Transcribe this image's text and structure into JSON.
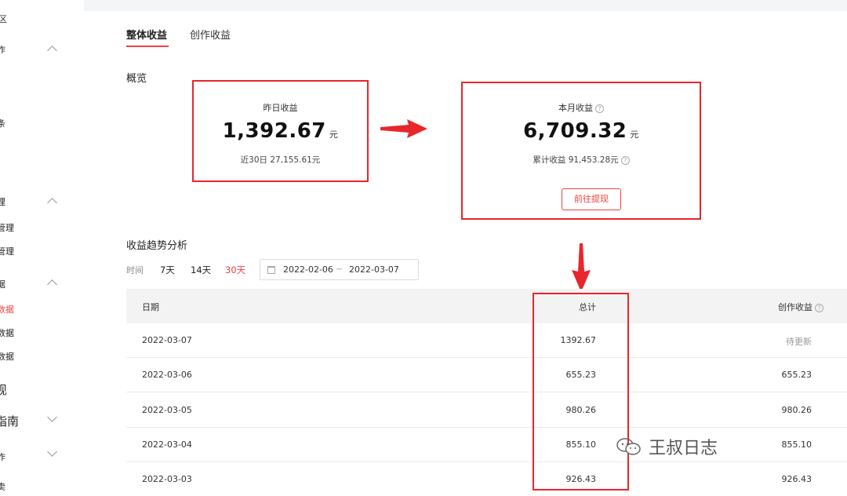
{
  "sidebar": {
    "items": [
      {
        "label": "区"
      },
      {
        "label": "作"
      },
      {
        "label": "条"
      },
      {
        "label": "理"
      },
      {
        "label": "管理"
      },
      {
        "label": "管理"
      },
      {
        "label": "据"
      },
      {
        "label": "数据"
      },
      {
        "label": "数据"
      },
      {
        "label": "数据"
      },
      {
        "label": "现"
      },
      {
        "label": "指南"
      },
      {
        "label": "作"
      },
      {
        "label": "卖"
      }
    ]
  },
  "tabs": [
    {
      "label": "整体收益",
      "active": true
    },
    {
      "label": "创作收益",
      "active": false
    }
  ],
  "overview": {
    "title": "概览",
    "yesterday": {
      "label": "昨日收益",
      "value": "1,392.67",
      "unit": "元",
      "sub": "近30日 27,155.61元"
    },
    "month": {
      "label": "本月收益",
      "value": "6,709.32",
      "unit": "元",
      "sub": "累计收益 91,453.28元",
      "button": "前往提现"
    }
  },
  "trend": {
    "title": "收益趋势分析",
    "filter_label": "时间",
    "ranges": [
      {
        "label": "7天",
        "active": false
      },
      {
        "label": "14天",
        "active": false
      },
      {
        "label": "30天",
        "active": true
      }
    ],
    "date_start": "2022-02-06",
    "date_sep": "~",
    "date_end": "2022-03-07"
  },
  "table": {
    "headers": {
      "date": "日期",
      "total": "总计",
      "creation": "创作收益"
    },
    "rows": [
      {
        "date": "2022-03-07",
        "total": "1392.67",
        "creation": "待更新"
      },
      {
        "date": "2022-03-06",
        "total": "655.23",
        "creation": "655.23"
      },
      {
        "date": "2022-03-05",
        "total": "980.26",
        "creation": "980.26"
      },
      {
        "date": "2022-03-04",
        "total": "855.10",
        "creation": "855.10"
      },
      {
        "date": "2022-03-03",
        "total": "926.43",
        "creation": "926.43"
      }
    ]
  },
  "watermark": "王叔日志",
  "colors": {
    "accent": "#f04142",
    "annotation": "#e8262b"
  }
}
